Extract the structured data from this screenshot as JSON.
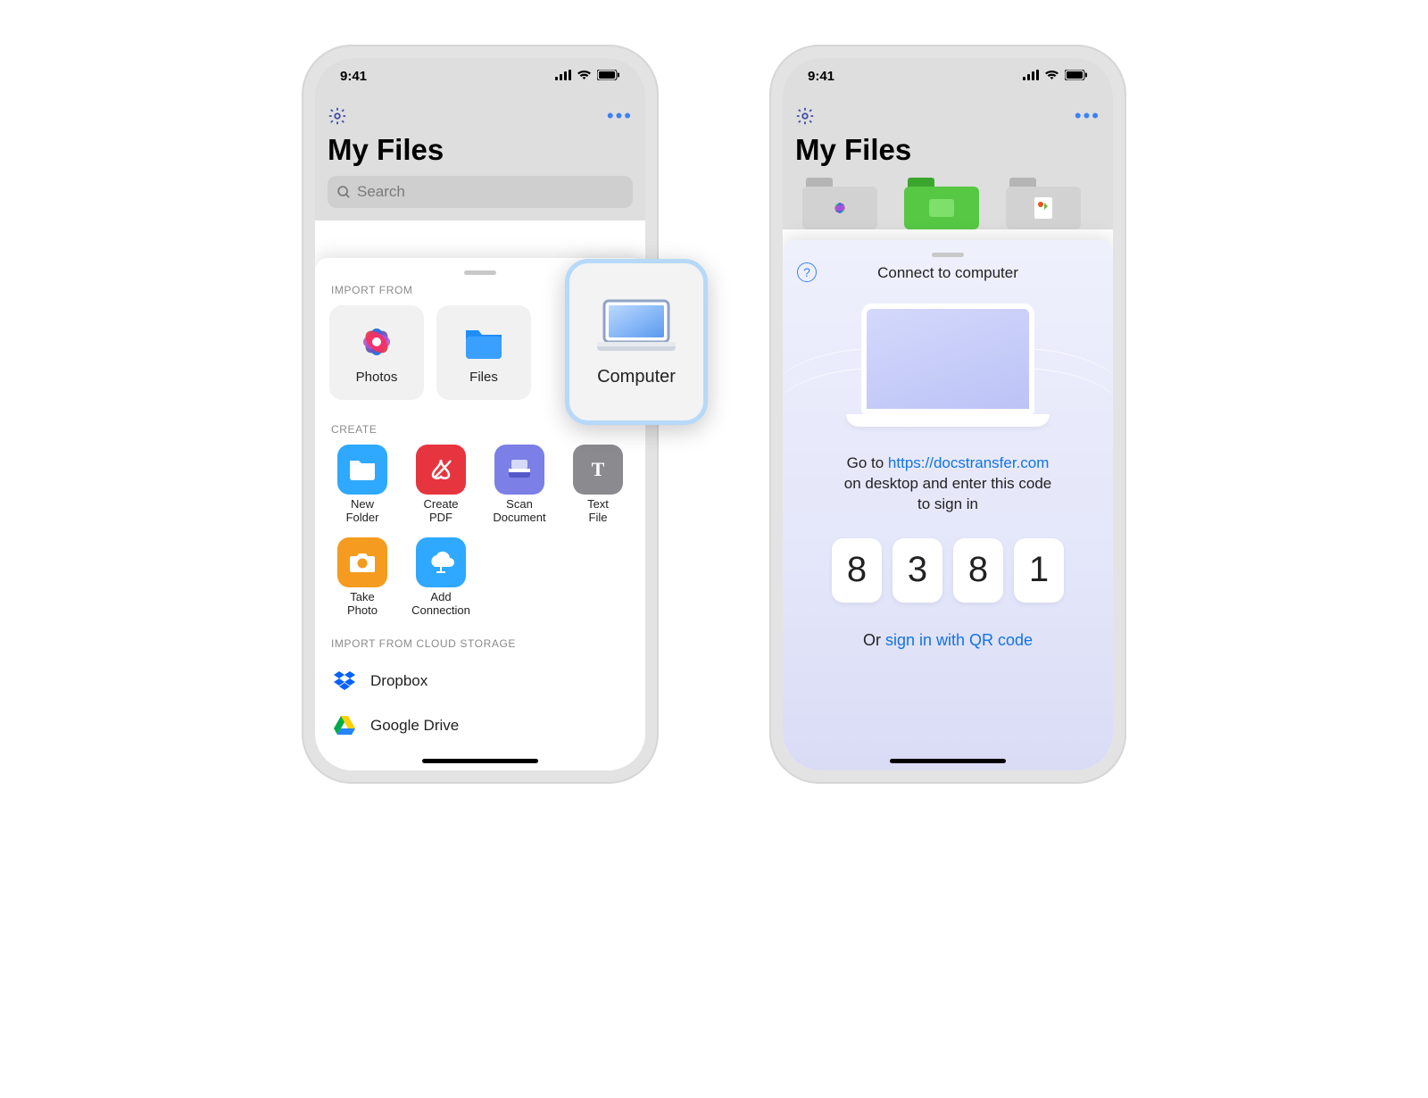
{
  "status": {
    "time": "9:41"
  },
  "header": {
    "title": "My Files",
    "search_placeholder": "Search"
  },
  "import": {
    "section_label": "IMPORT FROM",
    "tiles": [
      {
        "label": "Photos"
      },
      {
        "label": "Files"
      },
      {
        "label": "Computer"
      }
    ]
  },
  "create": {
    "section_label": "CREATE",
    "tiles": [
      {
        "label": "New\nFolder",
        "bg": "#2EA9FF"
      },
      {
        "label": "Create\nPDF",
        "bg": "#E6353F"
      },
      {
        "label": "Scan\nDocument",
        "bg": "#7B7FE6"
      },
      {
        "label": "Text\nFile",
        "bg": "#8A8A8F"
      },
      {
        "label": "Take\nPhoto",
        "bg": "#F59B1F"
      },
      {
        "label": "Add\nConnection",
        "bg": "#2EA9FF"
      }
    ]
  },
  "cloud": {
    "section_label": "IMPORT FROM CLOUD STORAGE",
    "items": [
      {
        "label": "Dropbox"
      },
      {
        "label": "Google Drive"
      }
    ]
  },
  "connect": {
    "title": "Connect to computer",
    "prefix": "Go to ",
    "url": "https://docstransfer.com",
    "suffix1": "on desktop and enter this code",
    "suffix2": "to sign in",
    "code": [
      "8",
      "3",
      "8",
      "1"
    ],
    "alt_prefix": "Or ",
    "alt_link": "sign in with QR code"
  }
}
